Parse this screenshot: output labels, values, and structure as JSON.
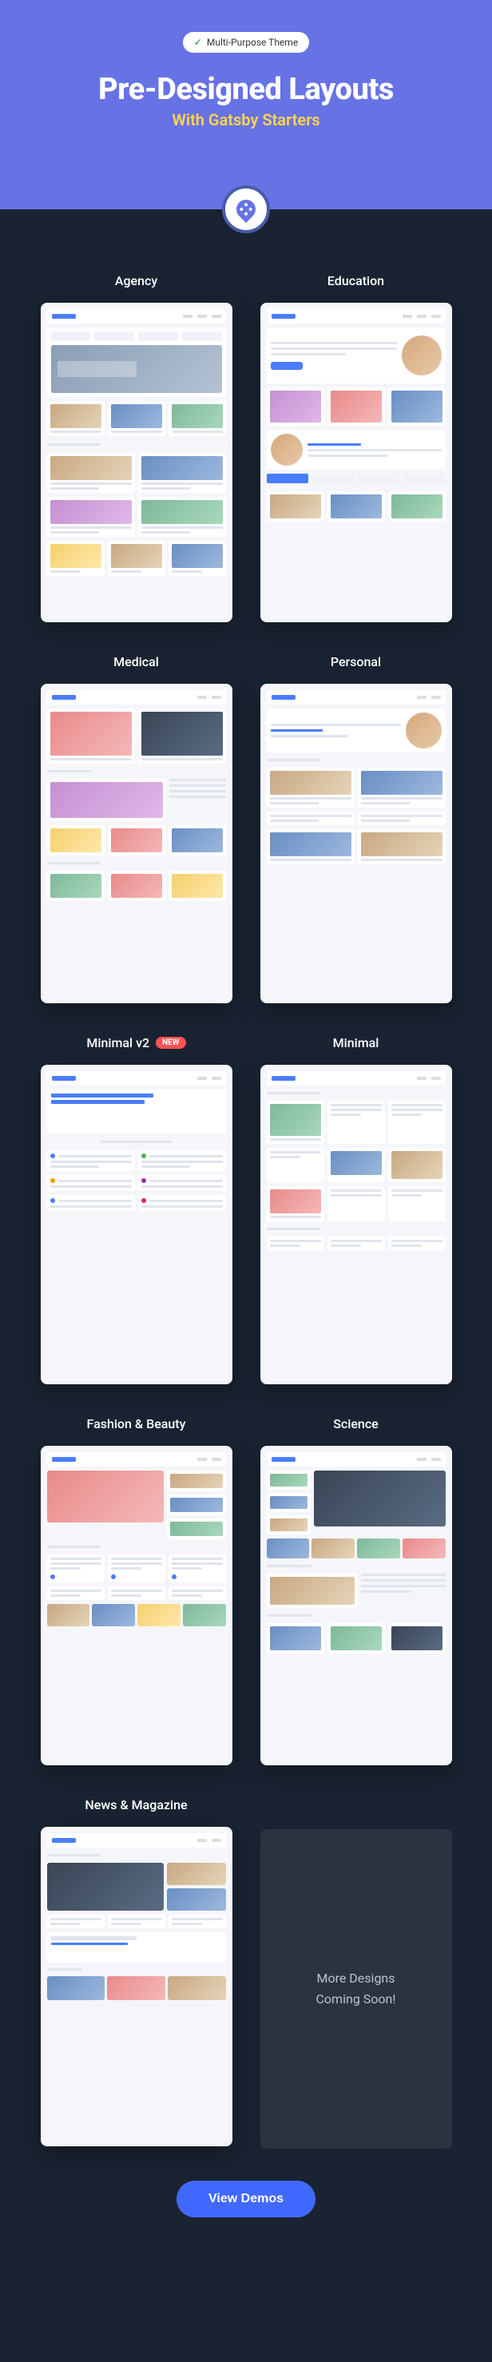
{
  "hero": {
    "badge": "Multi-Purpose Theme",
    "title": "Pre-Designed Layouts",
    "subtitle": "With Gatsby Starters"
  },
  "layouts": [
    {
      "label": "Agency",
      "new": false
    },
    {
      "label": "Education",
      "new": false
    },
    {
      "label": "Medical",
      "new": false
    },
    {
      "label": "Personal",
      "new": false
    },
    {
      "label": "Minimal v2",
      "new": true
    },
    {
      "label": "Minimal",
      "new": false
    },
    {
      "label": "Fashion & Beauty",
      "new": false
    },
    {
      "label": "Science",
      "new": false
    },
    {
      "label": "News & Magazine",
      "new": false
    }
  ],
  "newBadge": "NEW",
  "coming": {
    "line1": "More Designs",
    "line2": "Coming Soon!"
  },
  "cta": "View Demos"
}
